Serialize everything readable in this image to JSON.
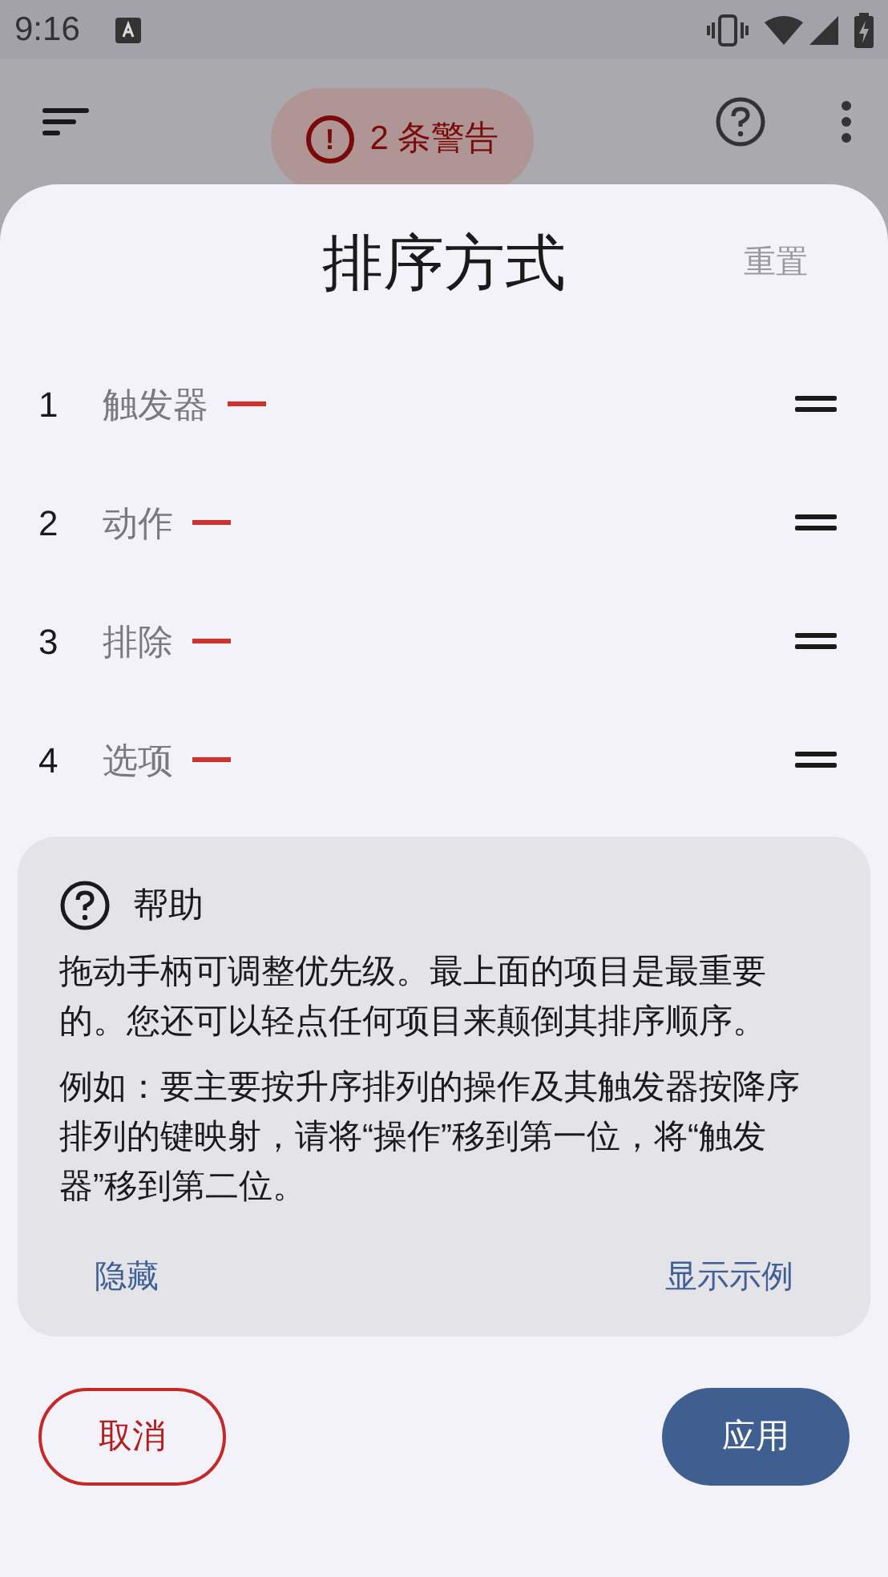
{
  "status_bar": {
    "time": "9:16"
  },
  "app_bar": {
    "warning_chip": {
      "icon": "!",
      "label": "2 条警告"
    }
  },
  "sheet": {
    "title": "排序方式",
    "reset": "重置",
    "items": [
      {
        "number": "1",
        "label": "触发器"
      },
      {
        "number": "2",
        "label": "动作"
      },
      {
        "number": "3",
        "label": "排除"
      },
      {
        "number": "4",
        "label": "选项"
      }
    ],
    "help": {
      "title": "帮助",
      "paragraphs": [
        "拖动手柄可调整优先级。最上面的项目是最重要的。您还可以轻点任何项目来颠倒其排序顺序。",
        "例如：要主要按升序排列的操作及其触发器按降序排列的键映射，请将“操作”移到第一位，将“触发器”移到第二位。"
      ],
      "hide": "隐藏",
      "show_example": "显示示例"
    },
    "cancel": "取消",
    "apply": "应用"
  }
}
